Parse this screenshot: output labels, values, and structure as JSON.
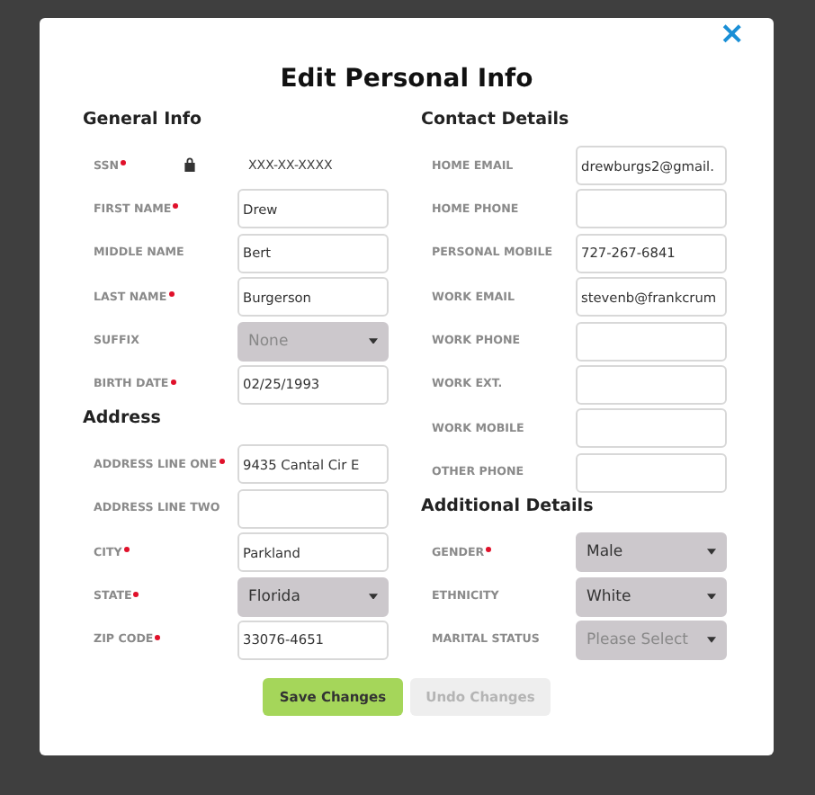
{
  "dialog": {
    "title": "Edit Personal Info",
    "close": "×"
  },
  "columns": [
    [
      {
        "heading": "General Info",
        "fields": [
          {
            "label": "SSN",
            "required": true,
            "kind": "locked",
            "value": "XXX-XX-XXXX"
          },
          {
            "label": "FIRST NAME",
            "required": true,
            "kind": "text",
            "value": "Drew"
          },
          {
            "label": "MIDDLE NAME",
            "required": false,
            "kind": "text",
            "value": "Bert"
          },
          {
            "label": "LAST NAME",
            "required": true,
            "kind": "text",
            "value": "Burgerson"
          },
          {
            "label": "SUFFIX",
            "required": false,
            "kind": "select",
            "placeholder": "None"
          },
          {
            "label": "BIRTH DATE",
            "required": true,
            "kind": "text",
            "value": "02/25/1993"
          }
        ]
      },
      {
        "heading": "Address",
        "fields": [
          {
            "label": "ADDRESS LINE ONE",
            "required": true,
            "kind": "text",
            "value": "9435 Cantal Cir E"
          },
          {
            "label": "ADDRESS LINE TWO",
            "required": false,
            "kind": "text"
          },
          {
            "label": "CITY",
            "required": true,
            "kind": "text",
            "value": "Parkland"
          },
          {
            "label": "STATE",
            "required": true,
            "kind": "select",
            "value": "Florida"
          },
          {
            "label": "ZIP CODE",
            "required": true,
            "kind": "text",
            "value": "33076-4651"
          }
        ]
      }
    ],
    [
      {
        "heading": "Contact Details",
        "fields": [
          {
            "label": "HOME EMAIL",
            "required": false,
            "kind": "text",
            "value": "drewburgs2@gmail."
          },
          {
            "label": "HOME PHONE",
            "required": false,
            "kind": "text"
          },
          {
            "label": "PERSONAL MOBILE",
            "required": false,
            "kind": "text",
            "value": "727-267-6841"
          },
          {
            "label": "WORK EMAIL",
            "required": false,
            "kind": "text",
            "value": "stevenb@frankcrum"
          },
          {
            "label": "WORK PHONE",
            "required": false,
            "kind": "text"
          },
          {
            "label": "WORK EXT.",
            "required": false,
            "kind": "text"
          },
          {
            "label": "WORK MOBILE",
            "required": false,
            "kind": "text"
          },
          {
            "label": "OTHER PHONE",
            "required": false,
            "kind": "text"
          }
        ]
      },
      {
        "heading": "Additional Details",
        "fields": [
          {
            "label": "GENDER",
            "required": true,
            "kind": "select",
            "value": "Male"
          },
          {
            "label": "ETHNICITY",
            "required": false,
            "kind": "select",
            "value": "White"
          },
          {
            "label": "MARITAL STATUS",
            "required": false,
            "kind": "select",
            "placeholder": "Please Select"
          }
        ]
      }
    ]
  ],
  "buttons": [
    {
      "label": "Save Changes",
      "disabled": false
    },
    {
      "label": "Undo Changes",
      "disabled": true
    }
  ]
}
